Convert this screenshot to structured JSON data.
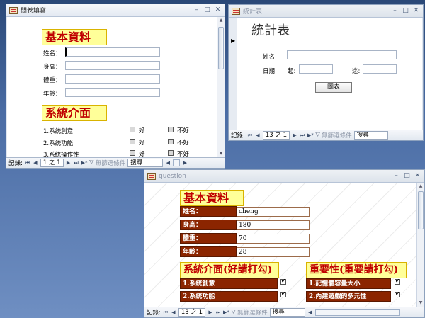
{
  "window1": {
    "title": "問卷填寫",
    "section1_heading": "基本資料",
    "fields": [
      {
        "label": "姓名："
      },
      {
        "label": "身高："
      },
      {
        "label": "體重："
      },
      {
        "label": "年齡："
      }
    ],
    "section2_heading": "系統介面",
    "items": [
      {
        "label": "1.系統創意",
        "good": "好",
        "bad": "不好"
      },
      {
        "label": "2.系統功能",
        "good": "好",
        "bad": "不好"
      },
      {
        "label": "3.系統操作性",
        "good": "好",
        "bad": "不好"
      }
    ],
    "nav": {
      "label": "記錄:",
      "position": "1 之 1",
      "filter": "無篩選條件",
      "search": "搜尋"
    }
  },
  "window2": {
    "title": "統計表",
    "heading": "統計表",
    "name_label": "姓名",
    "date_label": "日期",
    "from_label": "起:",
    "to_label": "迄:",
    "button": "圖表",
    "nav": {
      "label": "記錄:",
      "position": "13 之 1",
      "filter": "無篩選條件",
      "search": "搜尋"
    }
  },
  "window3": {
    "title": "question",
    "section1_heading": "基本資料",
    "fields": [
      {
        "label": "姓名：",
        "value": "cheng"
      },
      {
        "label": "身高：",
        "value": "180"
      },
      {
        "label": "體重：",
        "value": "70"
      },
      {
        "label": "年齡：",
        "value": "28"
      }
    ],
    "section2_heading": "系統介面(好請打勾)",
    "section3_heading": "重要性(重要請打勾)",
    "left_items": [
      "1.系統創意",
      "2.系統功能"
    ],
    "right_items": [
      "1.記憶體容量大小",
      "2.內建遊戲的多元性"
    ],
    "nav": {
      "label": "記錄:",
      "position": "13 之 1",
      "filter": "無篩選條件",
      "search": "搜尋"
    }
  }
}
